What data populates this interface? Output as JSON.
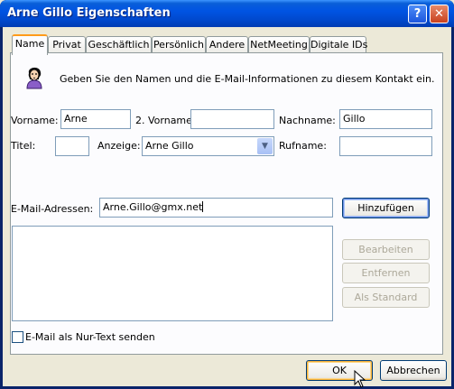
{
  "window": {
    "title": "Arne Gillo Eigenschaften",
    "help_glyph": "?",
    "close_glyph": "✕"
  },
  "tabs": [
    "Name",
    "Privat",
    "Geschäftlich",
    "Persönlich",
    "Andere",
    "NetMeeting",
    "Digitale IDs"
  ],
  "active_tab": "Name",
  "header": {
    "icon": "contact-person-icon",
    "text": "Geben Sie den Namen und die E-Mail-Informationen zu diesem Kontakt ein."
  },
  "fields": {
    "vorname": {
      "label": "Vorname:",
      "value": "Arne"
    },
    "vorname2": {
      "label": "2. Vorname:",
      "value": ""
    },
    "nachname": {
      "label": "Nachname:",
      "value": "Gillo"
    },
    "titel": {
      "label": "Titel:",
      "value": ""
    },
    "anzeige": {
      "label": "Anzeige:",
      "value": "Arne Gillo"
    },
    "rufname": {
      "label": "Rufname:",
      "value": ""
    }
  },
  "email": {
    "label": "E-Mail-Adressen:",
    "value": "Arne.Gillo@gmx.net",
    "add_button": "Hinzufügen",
    "edit_button": "Bearbeiten",
    "remove_button": "Entfernen",
    "default_button": "Als Standard",
    "list": []
  },
  "plain_text": {
    "label": "E-Mail als Nur-Text senden",
    "checked": false
  },
  "footer": {
    "ok": "OK",
    "cancel": "Abbrechen"
  },
  "colors": {
    "titlebar": "#0054e3",
    "dialog_bg": "#ece9d8",
    "focus_border": "#003c74"
  }
}
